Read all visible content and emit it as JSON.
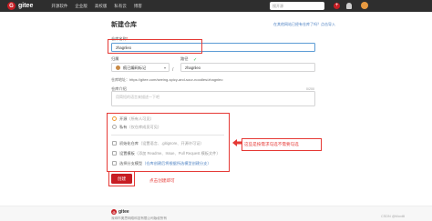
{
  "nav": {
    "logo_letter": "G",
    "logo_text": "gitee",
    "items": [
      "开源软件",
      "企业版",
      "高校版",
      "私有云",
      "博客"
    ],
    "search_placeholder": "搜开源"
  },
  "form": {
    "title": "新建仓库",
    "import_link": "在其他网站已经有仓库了吗？点击导入",
    "name_label": "仓库名称",
    "name_value": "zhagnleo",
    "owner_label": "归属",
    "owner_value": "痕已编码标记",
    "path_label": "路径",
    "path_value": "zhagnleo",
    "path_separator": "/",
    "address_label": "仓库地址：",
    "address_value": "https://gitee.com/seeing-spicy-and-sour-noodles/zhagnleo",
    "intro_label": "仓库介绍",
    "intro_counter": "0/200",
    "intro_placeholder": "用简短的语言来描述一下吧",
    "visibility": [
      {
        "name": "开源",
        "note": "（所有人可见）"
      },
      {
        "name": "私有",
        "note": "（仅仓库成员可见）"
      }
    ],
    "init_options": [
      {
        "name": "初始化仓库",
        "note": "（设置语言、.gitignore、开源许可证）"
      },
      {
        "name": "设置模板",
        "note": "（添加 Readme、Issue、Pull Request 模板文件）"
      },
      {
        "name": "选择分支模型",
        "note": "（仓库创建后将根据所选模型创建分支）"
      }
    ],
    "create_button": "创建"
  },
  "annotations": {
    "side_note": "这些是按需求勾选不需要勾选",
    "bottom_note": "点击创建即可"
  },
  "footer": {
    "logo_letter": "G",
    "logo_text": "gitee",
    "sub": "深圳市奥思网络科技有限公司版权所有",
    "watermark": "CSDN @Moxilli"
  },
  "colors": {
    "brand": "#c71d23",
    "annotation": "#e53935",
    "nav_bg": "#2e2e2e"
  }
}
